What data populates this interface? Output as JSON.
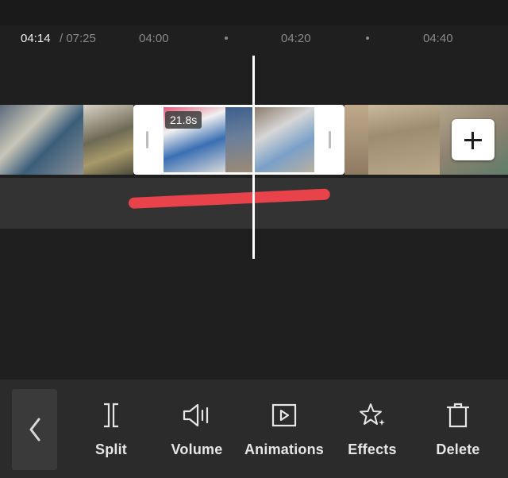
{
  "timeline": {
    "current_time": "04:14",
    "total_time": "/ 07:25",
    "ticks": [
      "04:00",
      "04:20",
      "04:40"
    ]
  },
  "selected_clip": {
    "duration": "21.8s"
  },
  "colors": {
    "background": "#1f1f1f",
    "toolbar": "#2b2b2b",
    "annotation_stroke": "#e8424a",
    "playhead": "#ffffff"
  },
  "toolbar": {
    "back_icon": "chevron-left-icon",
    "tools": [
      {
        "label": "Split",
        "icon": "split-icon"
      },
      {
        "label": "Volume",
        "icon": "volume-icon"
      },
      {
        "label": "Animations",
        "icon": "animations-icon"
      },
      {
        "label": "Effects",
        "icon": "effects-icon"
      },
      {
        "label": "Delete",
        "icon": "delete-icon"
      }
    ]
  }
}
